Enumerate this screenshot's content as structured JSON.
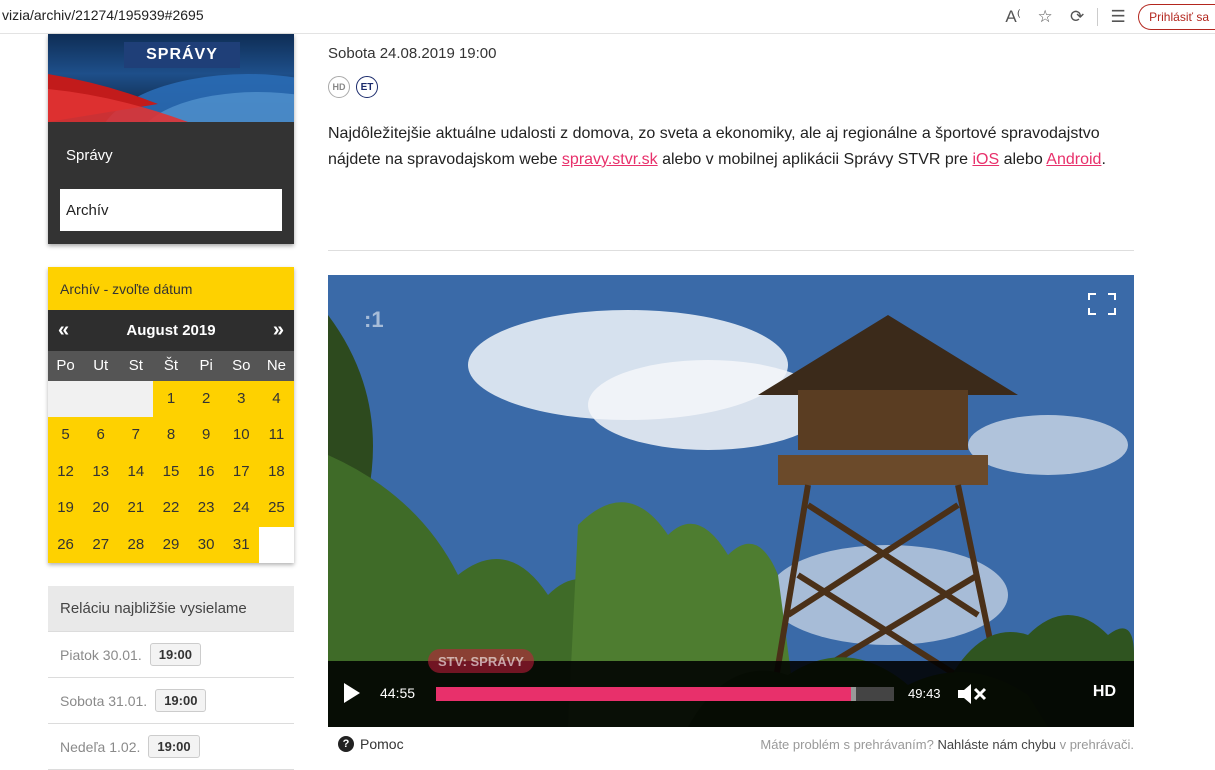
{
  "browser": {
    "url": "vizia/archiv/21274/195939#2695",
    "login_label": "Prihlásiť sa"
  },
  "sidebar": {
    "show_logo": "SPRÁVY",
    "show_name": "Správy",
    "archive_button": "Archív"
  },
  "calendar": {
    "header": "Archív - zvoľte dátum",
    "prev": "«",
    "next": "»",
    "month": "August 2019",
    "weekdays": [
      "Po",
      "Ut",
      "St",
      "Št",
      "Pi",
      "So",
      "Ne"
    ],
    "days": [
      "",
      "",
      "",
      "1",
      "2",
      "3",
      "4",
      "5",
      "6",
      "7",
      "8",
      "9",
      "10",
      "11",
      "12",
      "13",
      "14",
      "15",
      "16",
      "17",
      "18",
      "19",
      "20",
      "21",
      "22",
      "23",
      "24",
      "25",
      "26",
      "27",
      "28",
      "29",
      "30",
      "31",
      ""
    ]
  },
  "next_broadcast": {
    "header": "Reláciu najbližšie vysielame",
    "rows": [
      {
        "day": "Piatok 30.01.",
        "time": "19:00"
      },
      {
        "day": "Sobota 31.01.",
        "time": "19:00"
      },
      {
        "day": "Nedeľa 1.02.",
        "time": "19:00"
      }
    ]
  },
  "main": {
    "broadcast_date": "Sobota 24.08.2019 19:00",
    "badges": [
      "HD",
      "ET"
    ],
    "desc_part1": "Najdôležitejšie aktuálne udalosti z domova, zo sveta a ekonomiky, ale aj regionálne a športové spravodajstvo nájdete na spravodajskom webe ",
    "link_web": "spravy.stvr.sk",
    "desc_part2": " alebo v mobilnej aplikácii Správy STVR pre ",
    "link_ios": "iOS",
    "desc_part3": " alebo ",
    "link_android": "Android",
    "desc_part4": "."
  },
  "player": {
    "watermark": ":1",
    "overlay_logo": "STV: SPRÁVY",
    "current_time": "44:55",
    "total_time": "49:43",
    "progress": 0.91,
    "quality": "HD"
  },
  "footer": {
    "help": "Pomoc",
    "problem_prefix": "Máte problém s prehrávaním?",
    "problem_link": "Nahláste nám chybu",
    "problem_suffix": "v prehrávači."
  },
  "colors": {
    "accent_pink": "#e8306b",
    "calendar_yellow": "#fed100",
    "dark_panel": "#333333"
  }
}
